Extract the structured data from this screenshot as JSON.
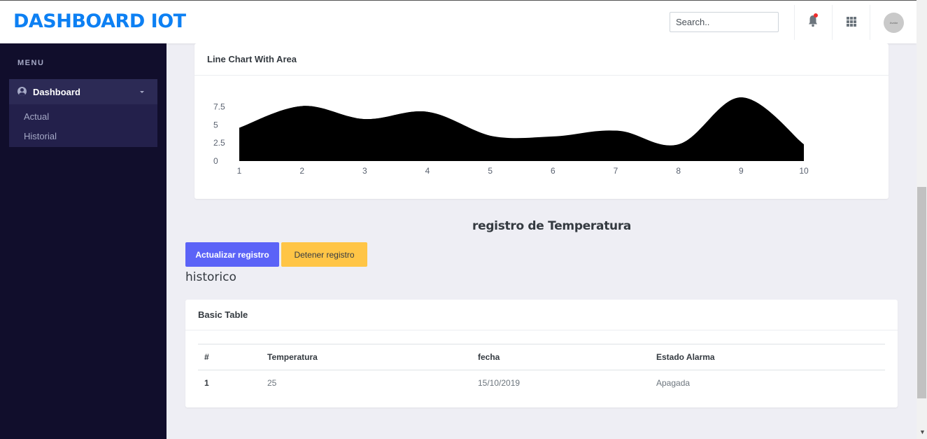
{
  "header": {
    "brand": "DASHBOARD IOT",
    "search_placeholder": "Search..",
    "avatar_text": "Avatar"
  },
  "sidebar": {
    "menu_title": "MENU",
    "main_item": "Dashboard",
    "items": [
      {
        "label": "Actual"
      },
      {
        "label": "Historial"
      }
    ]
  },
  "chart_card": {
    "title": "Line Chart With Area"
  },
  "chart_data": {
    "type": "area",
    "title": "",
    "xlabel": "",
    "ylabel": "",
    "x": [
      1,
      2,
      3,
      4,
      5,
      6,
      7,
      8,
      9,
      10
    ],
    "series": [
      {
        "values": [
          4.6,
          7.6,
          5.8,
          6.8,
          3.5,
          3.4,
          4.2,
          2.3,
          8.8,
          2.3
        ],
        "color": "#000000"
      },
      {
        "values": [
          4.6,
          7.6,
          5.8,
          6.8,
          3.5,
          2.2,
          4.2,
          2.3,
          8.8,
          2.3
        ],
        "color": "#000000"
      }
    ],
    "y_ticks": [
      "0",
      "2.5",
      "5",
      "7.5"
    ],
    "ylim": [
      0,
      9
    ],
    "grid": false
  },
  "section": {
    "title": "registro de Temperatura",
    "update_button": "Actualizar registro",
    "stop_button": "Detener registro",
    "history_label": "historico"
  },
  "table_card": {
    "title": "Basic Table",
    "columns": [
      "#",
      "Temperatura",
      "fecha",
      "Estado Alarma"
    ],
    "rows": [
      [
        "1",
        "25",
        "15/10/2019",
        "Apagada"
      ]
    ]
  },
  "colors": {
    "brand": "#0d80f3",
    "sidebar_bg": "#110e2c",
    "primary_button": "#5b63f7",
    "warning_button": "#ffc546",
    "notification_dot": "#f02d2d"
  }
}
